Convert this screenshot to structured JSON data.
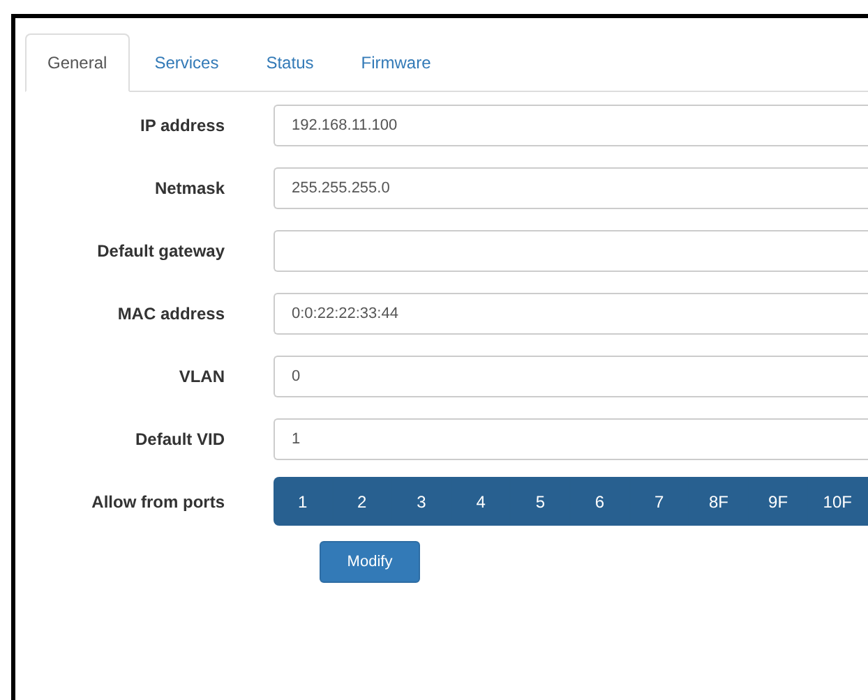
{
  "tabs": [
    {
      "label": "General",
      "selected": true
    },
    {
      "label": "Services",
      "selected": false
    },
    {
      "label": "Status",
      "selected": false
    },
    {
      "label": "Firmware",
      "selected": false
    }
  ],
  "fields": [
    {
      "label": "IP address",
      "value": "192.168.11.100"
    },
    {
      "label": "Netmask",
      "value": "255.255.255.0"
    },
    {
      "label": "Default gateway"
    },
    {
      "label": "MAC address",
      "value": "0:0:22:22:33:44"
    },
    {
      "label": "VLAN",
      "value": "0"
    },
    {
      "label": "Default VID",
      "value": "1"
    }
  ],
  "ports": {
    "label": "Allow from ports",
    "items": [
      {
        "label": "1",
        "selected": true
      },
      {
        "label": "2",
        "selected": true
      },
      {
        "label": "3",
        "selected": true
      },
      {
        "label": "4",
        "selected": true
      },
      {
        "label": "5",
        "selected": true
      },
      {
        "label": "6",
        "selected": true
      },
      {
        "label": "7",
        "selected": true
      },
      {
        "label": "8F",
        "selected": true
      },
      {
        "label": "9F",
        "selected": true
      },
      {
        "label": "10F",
        "selected": true
      }
    ]
  },
  "button": "Modify"
}
